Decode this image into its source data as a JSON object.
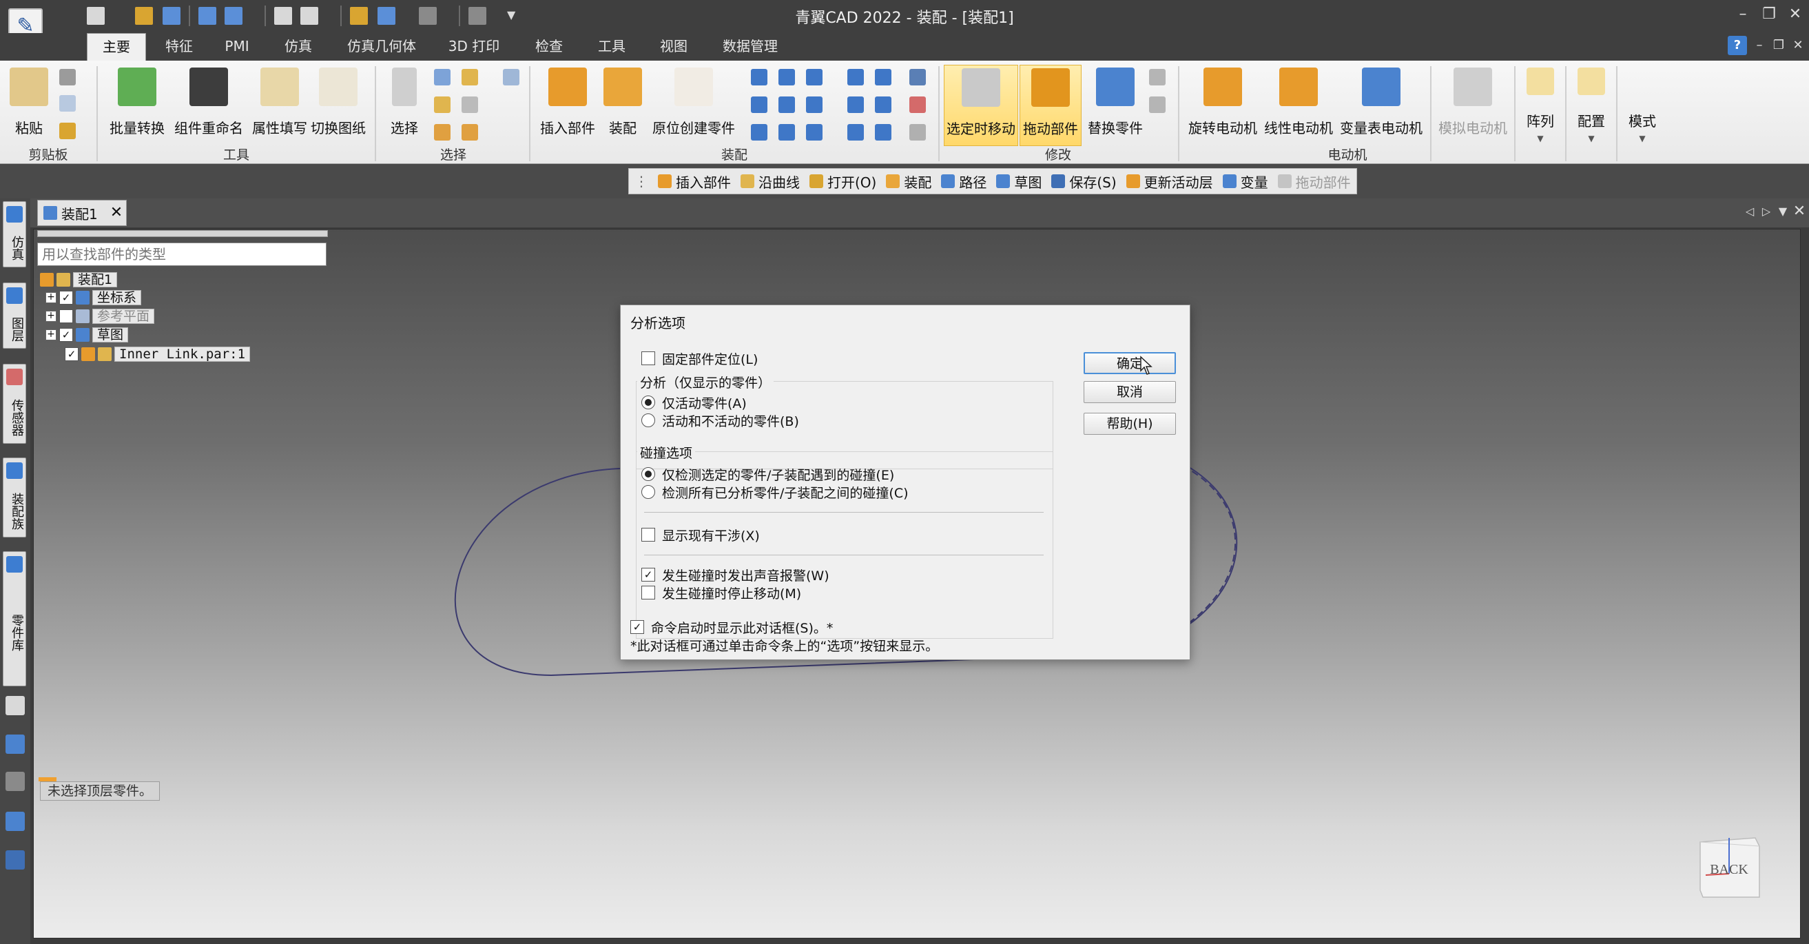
{
  "window": {
    "title": "青翼CAD 2022 - 装配 - [装配1]"
  },
  "tabs": [
    "主要",
    "特征",
    "PMI",
    "仿真",
    "仿真几何体",
    "3D 打印",
    "检查",
    "工具",
    "视图",
    "数据管理"
  ],
  "ribbon": {
    "clipboard": {
      "label": "剪贴板",
      "paste": "粘贴"
    },
    "tools": {
      "label": "工具",
      "buttons": [
        "批量转换",
        "组件重命名",
        "属性填写",
        "切换图纸"
      ]
    },
    "select": {
      "label": "选择",
      "button": "选择"
    },
    "assemble": {
      "label": "装配",
      "buttons": [
        "插入部件",
        "装配",
        "原位创建零件"
      ]
    },
    "modify": {
      "label": "修改",
      "buttons": [
        "选定时移动",
        "拖动部件",
        "替换零件"
      ]
    },
    "motor": {
      "label": "电动机",
      "buttons": [
        "旋转电动机",
        "线性电动机",
        "变量表电动机",
        "模拟电动机"
      ]
    },
    "extra": [
      "阵列",
      "配置",
      "模式"
    ]
  },
  "commandbar": {
    "items": [
      "插入部件",
      "沿曲线",
      "打开(O)",
      "装配",
      "路径",
      "草图",
      "保存(S)",
      "更新活动层",
      "变量",
      "拖动部件"
    ]
  },
  "siderail": {
    "tabs": [
      "仿真",
      "图层",
      "传感器",
      "装配族",
      "零件库"
    ]
  },
  "document": {
    "tab": "装配1"
  },
  "tree": {
    "search_placeholder": "用以查找部件的类型",
    "root": "装配1",
    "items": [
      {
        "label": "坐标系",
        "checked": true
      },
      {
        "label": "参考平面",
        "checked": false
      },
      {
        "label": "草图",
        "checked": true
      },
      {
        "label": "Inner Link.par:1",
        "checked": true
      }
    ]
  },
  "status": {
    "message": "未选择顶层零件。"
  },
  "viewcube": {
    "label": "BACK"
  },
  "dialog": {
    "title": "分析选项",
    "fix_position": {
      "label": "固定部件定位(L)",
      "checked": false
    },
    "analysis": {
      "legend": "分析（仅显示的零件）",
      "options": [
        "仅活动零件(A)",
        "活动和不活动的零件(B)"
      ],
      "selected": 0
    },
    "collision": {
      "legend": "碰撞选项",
      "options": [
        "仅检测选定的零件/子装配遇到的碰撞(E)",
        "检测所有已分析零件/子装配之间的碰撞(C)"
      ],
      "selected": 0
    },
    "show_interference": {
      "label": "显示现有干涉(X)",
      "checked": false
    },
    "sound_alarm": {
      "label": "发生碰撞时发出声音报警(W)",
      "checked": true
    },
    "stop_moving": {
      "label": "发生碰撞时停止移动(M)",
      "checked": false
    },
    "show_on_start": {
      "label": "命令启动时显示此对话框(S)。*",
      "checked": true
    },
    "footnote": "*此对话框可通过单击命令条上的“选项”按钮来显示。",
    "buttons": {
      "ok": "确定",
      "cancel": "取消",
      "help": "帮助(H)"
    }
  }
}
